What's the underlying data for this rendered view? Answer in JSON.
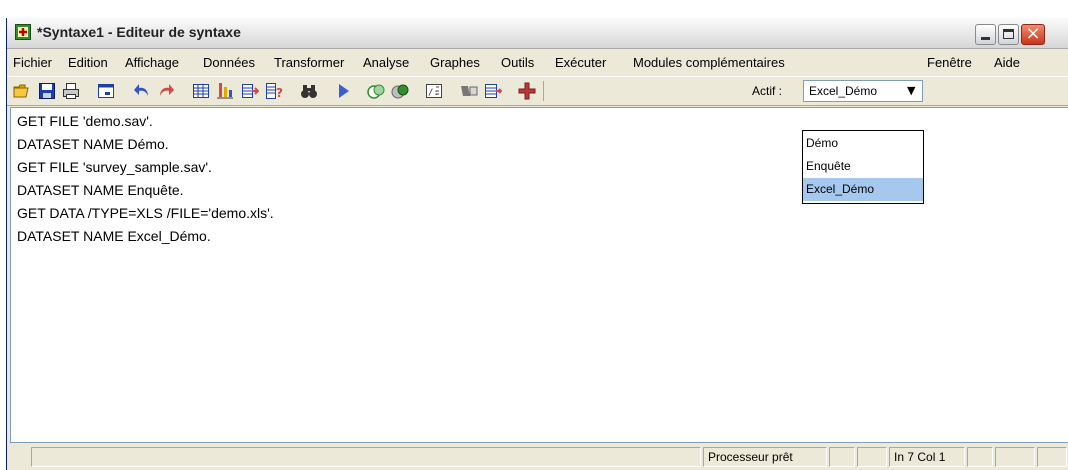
{
  "window": {
    "title": "*Syntaxe1 - Editeur de syntaxe",
    "close_symbol": "×"
  },
  "menu": {
    "items": [
      "Fichier",
      "Edition",
      "Affichage",
      "Données",
      "Transformer",
      "Analyse",
      "Graphes",
      "Outils",
      "Exécuter",
      "Modules complémentaires",
      "Fenêtre",
      "Aide"
    ]
  },
  "toolbar": {
    "icons": [
      "open-icon",
      "save-icon",
      "print-icon",
      "dialog-recall-icon",
      "undo-icon",
      "redo-icon",
      "goto-case-icon",
      "goto-variable-icon",
      "variables-icon",
      "use-sets-icon",
      "find-icon",
      "run-icon",
      "value-labels-icon",
      "show-sets-icon",
      "syntax-help-icon",
      "designate-window-icon",
      "spelling-icon",
      "add-icon"
    ],
    "active_label": "Actif :",
    "active_dataset": "Excel_Démo",
    "arrow": "▼"
  },
  "editor": {
    "lines": [
      "GET FILE 'demo.sav'.",
      "DATASET NAME Démo.",
      "GET FILE 'survey_sample.sav'.",
      "DATASET NAME Enquête.",
      "GET DATA /TYPE=XLS /FILE='demo.xls'.",
      "DATASET NAME Excel_Démo."
    ]
  },
  "dropdown": {
    "options": [
      "Démo",
      "Enquête",
      "Excel_Démo"
    ],
    "selected": "Excel_Démo"
  },
  "status": {
    "processor": "Processeur prêt",
    "position": "In 7 Col 1"
  },
  "colors": {
    "selection": "#a6c8ee",
    "run_arrow": "#3a5fd0"
  }
}
